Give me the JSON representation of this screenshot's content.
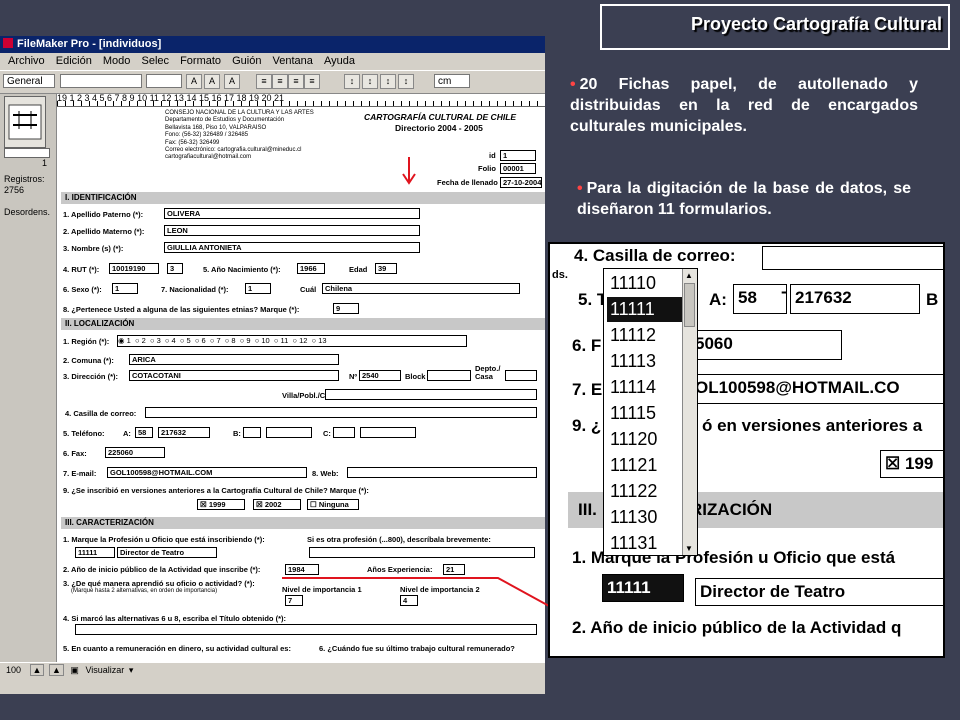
{
  "slide": {
    "title": "Proyecto Cartografía Cultural",
    "bullets": [
      "20 Fichas papel, de autollenado y distribuidas en la red de encargados culturales municipales.",
      "Para la digitación de la base de datos, se diseñaron 11 formularios."
    ],
    "colors": {
      "background": "#3b3f52",
      "bullet_dot": "#ff4444",
      "arrow": "#e0141e"
    }
  },
  "filemaker": {
    "title": "FileMaker Pro - [individuos]",
    "menu": [
      "Archivo",
      "Edición",
      "Modo",
      "Selec",
      "Formato",
      "Guión",
      "Ventana",
      "Ayuda"
    ],
    "toolbar": {
      "style_select": "General",
      "unit_select": "cm"
    },
    "sidebar": {
      "records_label": "Registros:",
      "records_count": "2756",
      "sort_label": "Desordens.",
      "page_number": "1"
    },
    "ruler_text": "19  1  2  3  4  5  6  7  8  9  10  11  12  13  14  15  16  17  18  19  20  21",
    "status": {
      "zoom": "100",
      "mode": "Visualizar"
    },
    "form": {
      "header_lines": [
        "CONSEJO NACIONAL DE LA CULTURA Y LAS ARTES",
        "Departamento de Estudios y Documentación",
        "Bellavista 168, Piso 10, VALPARAISO",
        "Fono: (56-32) 326489 / 326485",
        "Fax: (56-32) 326499",
        "Correo electrónico: cartografia.cultural@mineduc.cl",
        "cartografiacultural@hotmail.com"
      ],
      "doc_title": "CARTOGRAFÍA CULTURAL DE CHILE",
      "doc_subtitle": "Directorio 2004 - 2005",
      "id_label": "id",
      "id_value": "1",
      "folio_label": "Folio",
      "folio_value": "00001",
      "fecha_label": "Fecha de llenado",
      "fecha_value": "27-10-2004",
      "sec1": "I. IDENTIFICACIÓN",
      "apellido_paterno_label": "1. Apellido Paterno (*):",
      "apellido_paterno": "OLIVERA",
      "apellido_materno_label": "2. Apellido Materno (*):",
      "apellido_materno": "LEON",
      "nombres_label": "3. Nombre (s) (*):",
      "nombres": "GIULLIA ANTONIETA",
      "rut_label": "4. RUT (*):",
      "rut": "10019190",
      "rut_dv": "3",
      "anio_nac_label": "5. Año Nacimiento (*):",
      "anio_nac": "1966",
      "edad_label": "Edad",
      "edad": "39",
      "sexo_label": "6. Sexo (*):",
      "sexo": "1",
      "nacionalidad_label": "7. Nacionalidad (*):",
      "nacionalidad": "1",
      "cual_label": "Cuál",
      "cual": "Chilena",
      "etnia_label": "8. ¿Pertenece Usted a alguna de las siguientes etnias? Marque (*):",
      "etnia": "9",
      "sec2": "II. LOCALIZACIÓN",
      "region_label": "1. Región (*):",
      "region_options": [
        "1",
        "2",
        "3",
        "4",
        "5",
        "6",
        "7",
        "8",
        "9",
        "10",
        "11",
        "12",
        "13"
      ],
      "comuna_label": "2. Comuna (*):",
      "comuna": "ARICA",
      "direccion_label": "3. Dirección (*):",
      "direccion": "COTACOTANI",
      "numero_label": "Nº",
      "numero": "2540",
      "block_label": "Block",
      "depto_label": "Depto./ Casa",
      "villa_label": "Villa/Pobl./Cond.",
      "casilla_label": "4. Casilla de correo:",
      "telefono_label": "5. Teléfono:",
      "tel_a_label": "A:",
      "tel_a_code": "58",
      "tel_a_num": "217632",
      "tel_b_label": "B:",
      "tel_c_label": "C:",
      "fax_label": "6. Fax:",
      "fax": "225060",
      "email_label": "7. E-mail:",
      "email": "GOL100598@HOTMAIL.COM",
      "web_label": "8. Web:",
      "inscribio_label": "9. ¿Se inscribió en versiones anteriores a la Cartografía Cultural de Chile? Marque (*):",
      "inscr_1999": "1999",
      "inscr_2002": "2002",
      "inscr_ninguna": "Ninguna",
      "sec3": "III. CARACTERIZACIÓN",
      "profesion_label": "1. Marque la Profesión u Oficio que está inscribiendo (*):",
      "otra_prof_label": "Si es otra profesión (...800), descríbala brevemente:",
      "profesion_code": "11111",
      "profesion_name": "Director de Teatro",
      "anio_inicio_label": "2. Año de inicio público de la Actividad que inscribe (*):",
      "anio_inicio": "1984",
      "experiencia_label": "Años Experiencia:",
      "experiencia": "21",
      "aprendio_label": "3. ¿De qué manera aprendió su oficio o actividad? (*):",
      "aprendio_hint": "(Marque hasta 2 alternativas, en orden de importancia)",
      "nivel1_label": "Nivel de importancia 1",
      "nivel1": "7",
      "nivel2_label": "Nivel de importancia 2",
      "nivel2": "4",
      "titulo_label": "4. Si marcó las alternativas 6 u 8, escriba el Título obtenido (*):",
      "remuneracion_label": "5. En cuanto a remuneración en dinero, su actividad cultural es:",
      "ultimo_trabajo_label": "6. ¿Cuándo fue su último trabajo cultural remunerado?"
    }
  },
  "zoom": {
    "casilla_label": "4. Casilla de correo:",
    "telefono_label": "5. T",
    "tel_a_label": "A:",
    "tel_a_code": "58",
    "tel_a_num": "217632",
    "tel_b_label": "B",
    "fax_label": "6. F",
    "fax_partial": "5060",
    "email_label": "7. E",
    "email_partial": "OL100598@HOTMAIL.CO",
    "inscribio_label": "9. ¿",
    "inscribio_partial": "ó en versiones anteriores a",
    "inscr_partial": "199",
    "sec3_label": "III.",
    "sec3_partial": "RIZACIÓN",
    "profesion_label": "1. Marque la Profesión u Oficio que está",
    "profesion_code": "11111",
    "profesion_name": "Director de Teatro",
    "anio_label": "2. Año de inicio público de la Actividad q",
    "left_fragment": "ds.",
    "dropdown": [
      "11110",
      "11111",
      "11112",
      "11113",
      "11114",
      "11115",
      "11120",
      "11121",
      "11122",
      "11130",
      "11131"
    ],
    "dropdown_selected": "11111"
  }
}
